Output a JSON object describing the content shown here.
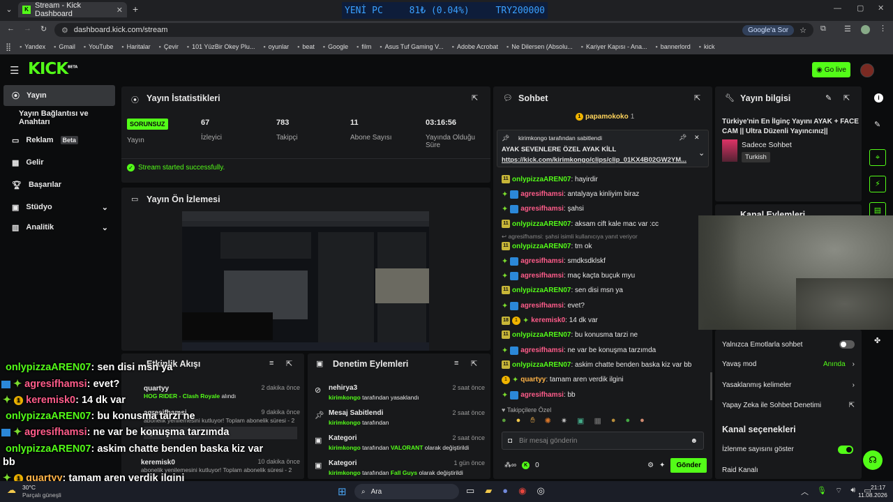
{
  "browser": {
    "tab_title": "Stream - Kick Dashboard",
    "url": "dashboard.kick.com/stream",
    "google_btn": "Google'a Sor",
    "bookmarks": [
      "Yandex",
      "Gmail",
      "YouTube",
      "Haritalar",
      "Çevir",
      "101 YüzBir Okey Plu...",
      "oyunlar",
      "beat",
      "Google",
      "film",
      "Asus Tuf Gaming V...",
      "Adobe Acrobat",
      "Ne Dilersen (Absolu...",
      "Kariyer Kapısı - Ana...",
      "bannerlord",
      "kick"
    ]
  },
  "ticker": {
    "name": "YENİ PC",
    "amount": "81₺ (0.04%)",
    "goal": "TRY200000"
  },
  "header": {
    "logo": "KICK",
    "logo_sup": "BETA",
    "go_live": "Go live"
  },
  "sidebar": {
    "items": [
      "Yayın",
      "Yayın Bağlantısı ve Anahtarı",
      "Reklam",
      "Gelir",
      "Başarılar",
      "Stüdyo",
      "Analitik"
    ],
    "beta_badge": "Beta"
  },
  "stats": {
    "title": "Yayın İstatistikleri",
    "status": "SORUNSUZ",
    "status_label": "Yayın",
    "viewers": "67",
    "viewers_label": "İzleyici",
    "followers": "783",
    "followers_label": "Takipçi",
    "subs": "11",
    "subs_label": "Abone Sayısı",
    "duration": "03:16:56",
    "duration_label": "Yayında Olduğu Süre",
    "success": "Stream started successfully."
  },
  "preview": {
    "title": "Yayın Ön İzlemesi"
  },
  "activity": {
    "title": "Etkinlik Akışı",
    "items": [
      {
        "user": "quartyy",
        "time": "2 dakika önce",
        "detail": "HOG RIDER - Clash Royale",
        "detail_suffix": " alındı"
      },
      {
        "user": "agresifhamsi",
        "time": "9 dakika önce",
        "detail": "abonelik yenilemesini kutluyor! Toplam abonelik süresi - 2",
        "extra": "hayırdır"
      },
      {
        "user": "keremisk0",
        "time": "10 dakika önce",
        "detail": "abonelik yenilemesini kutluyor! Toplam abonelik süresi - 2"
      }
    ]
  },
  "moderation": {
    "title": "Denetim Eylemleri",
    "items": [
      {
        "title": "nehirya3",
        "time": "2 saat önce",
        "by": "kirimkongo",
        "action": " tarafından yasaklandı"
      },
      {
        "title": "Mesaj Sabitlendi",
        "time": "2 saat önce",
        "by": "kirimkongo",
        "action": " tarafından"
      },
      {
        "title": "Kategori",
        "time": "2 saat önce",
        "by": "kirimkongo",
        "action": " tarafından ",
        "cat": "VALORANT",
        "after": " olarak değiştirildi"
      },
      {
        "title": "Kategori",
        "time": "1 gün önce",
        "by": "kirimkongo",
        "action": " tarafından ",
        "cat": "Fall Guys",
        "after": " olarak değiştirildi"
      }
    ]
  },
  "chat": {
    "title": "Sohbet",
    "top_gifter": "papamokoko",
    "top_gifter_count": "1",
    "pinned_by": "kirimkongo tarafından sabitlendi",
    "pinned_text": "AYAK SEVENLERE ÖZEL AYAK KİLL",
    "pinned_link": "https://kick.com/kirimkongo/clips/clip_01KX4B02GW2YM...",
    "reply_note": "agresifhamsi: şahsi isimli kullanıcıya yanıt veriyor",
    "messages": [
      {
        "user": "onlypizzaAREN07",
        "text": ": hayirdir",
        "kind": "sub"
      },
      {
        "user": "agresifhamsi",
        "text": ": antalyaya kinliyim biraz",
        "kind": "gift"
      },
      {
        "user": "agresifhamsi",
        "text": ": şahsi",
        "kind": "gift"
      },
      {
        "user": "onlypizzaAREN07",
        "text": ": aksam cift kale mac var :cc",
        "kind": "sub"
      },
      {
        "user": "onlypizzaAREN07",
        "text": ": tm ok",
        "kind": "sub"
      },
      {
        "user": "agresifhamsi",
        "text": ": smdksdklskf",
        "kind": "gift"
      },
      {
        "user": "agresifhamsi",
        "text": ": maç kaçta buçuk myu",
        "kind": "gift"
      },
      {
        "user": "onlypizzaAREN07",
        "text": ": sen disi msn ya",
        "kind": "sub"
      },
      {
        "user": "agresifhamsi",
        "text": ": evet?",
        "kind": "gift"
      },
      {
        "user": "keremisk0",
        "text": ": 14 dk var",
        "kind": "kerem"
      },
      {
        "user": "onlypizzaAREN07",
        "text": ": bu konusma tarzi ne",
        "kind": "sub"
      },
      {
        "user": "agresifhamsi",
        "text": ": ne var be konuşma tarzımda",
        "kind": "gift"
      },
      {
        "user": "onlypizzaAREN07",
        "text": ": askim chatte benden baska kiz var bb",
        "kind": "sub"
      },
      {
        "user": "quartyy",
        "text": ": tamam aren verdik ilgini",
        "kind": "quart"
      },
      {
        "user": "agresifhamsi",
        "text": ": bb",
        "kind": "gift"
      }
    ],
    "followers_only": "Takipçilere Özel",
    "input_placeholder": "Bir mesaj gönderin",
    "points": "0",
    "send": "Gönder"
  },
  "info": {
    "title": "Yayın bilgisi",
    "stream_title": "Türkiye'nin En İlginç Yayını AYAK + FACE CAM || Ultra Düzenli Yayıncınız||",
    "category": "Sadece Sohbet",
    "language": "Turkish",
    "actions_title": "Kanal Eylemleri",
    "settings": [
      {
        "label": "Yalnızca Emotlarla sohbet",
        "value": ""
      },
      {
        "label": "Yavaş mod",
        "value": "Anında"
      },
      {
        "label": "Yasaklanmış kelimeler",
        "value": ""
      },
      {
        "label": "Yapay Zeka ile Sohbet Denetimi",
        "value": ""
      }
    ],
    "options_title": "Kanal seçenekleri",
    "opt1": "İzlenme sayısını göster",
    "opt2": "Raid Kanalı"
  },
  "overlay": [
    {
      "user": "onlypizzaAREN07",
      "text": " : sen disi msn ya"
    },
    {
      "user": "agresifhamsi",
      "text": " : evet?"
    },
    {
      "user": "keremisk0",
      "text": " : 14 dk var"
    },
    {
      "user": "onlypizzaAREN07",
      "text": " : bu konusma tarzi ne"
    },
    {
      "user": "agresifhamsi",
      "text": " : ne var be konuşma tarzımda"
    },
    {
      "user": "onlypizzaAREN07",
      "text": " : askim chatte benden baska kiz var"
    },
    {
      "user": "",
      "text": "bb"
    },
    {
      "user": "quartyy",
      "text": " : tamam aren verdik ilgini"
    },
    {
      "user": "agresifhamsi",
      "text": " : bb"
    }
  ],
  "taskbar": {
    "weather_temp": "30°C",
    "weather_text": "Parçalı güneşli",
    "search": "Ara",
    "time": "21:17",
    "date": "11.08.2026"
  },
  "colors": {
    "brand": "#53fc18",
    "panel": "#18191b",
    "bg": "#0b0c0d",
    "pink": "#ff5c8a"
  }
}
